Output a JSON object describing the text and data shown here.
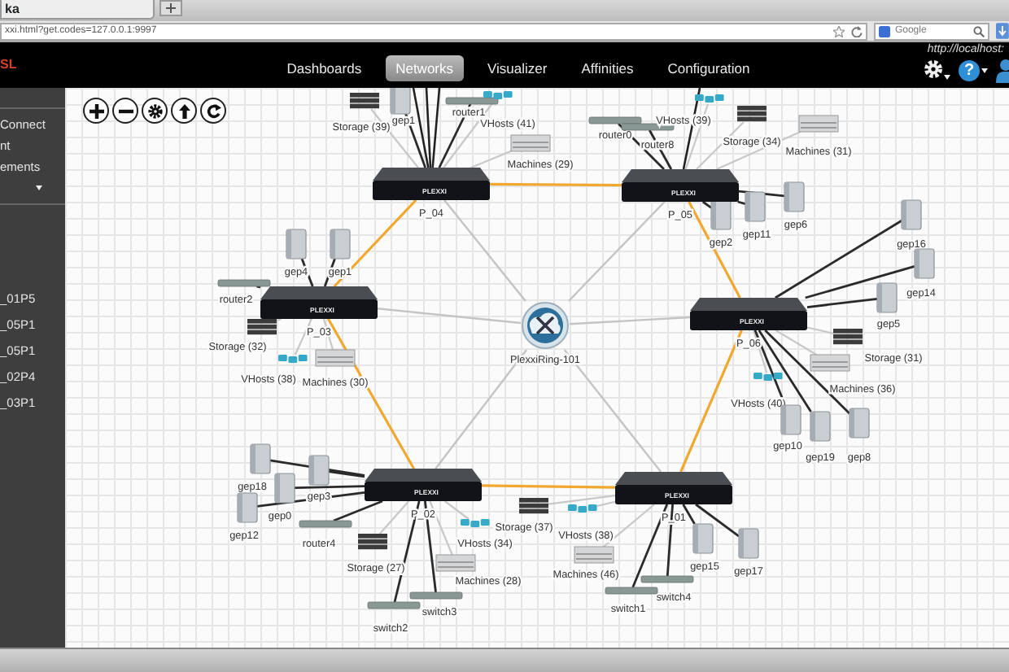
{
  "browser": {
    "tab_title": "ka",
    "url": "xxi.html?get.codes=127.0.0.1:9997",
    "search_placeholder": "Google"
  },
  "header": {
    "logo": "SL",
    "server_url": "http://localhost:",
    "help_glyph": "?",
    "nav": [
      {
        "label": "Dashboards",
        "selected": false
      },
      {
        "label": "Networks",
        "selected": true
      },
      {
        "label": "Visualizer",
        "selected": false
      },
      {
        "label": "Affinities",
        "selected": false
      },
      {
        "label": "Configuration",
        "selected": false
      }
    ]
  },
  "sidebar": {
    "sections": [
      {
        "items": [
          {
            "kind": "link",
            "label": "Connect"
          },
          {
            "kind": "link",
            "label": "nt"
          },
          {
            "kind": "link",
            "label": "ements"
          },
          {
            "kind": "dropdown"
          }
        ]
      },
      {
        "items": [
          {
            "kind": "link",
            "label": "_01P5"
          },
          {
            "kind": "link",
            "label": "_05P1"
          },
          {
            "kind": "link",
            "label": "_05P1"
          },
          {
            "kind": "link",
            "label": "_02P4"
          },
          {
            "kind": "link",
            "label": "_03P1"
          }
        ]
      }
    ]
  },
  "diagram": {
    "hub": {
      "label": "PlexxiRing-101"
    },
    "switches": [
      {
        "label": "P_04",
        "badge": "PLEXXI",
        "devices": [
          {
            "kind": "rack",
            "label": "Storage (39)"
          },
          {
            "kind": "server",
            "label": "gep1"
          },
          {
            "kind": "plate",
            "label": "router1"
          },
          {
            "kind": "vhosts",
            "label": "VHosts (41)"
          },
          {
            "kind": "chassis",
            "label": "Machines (29)"
          }
        ]
      },
      {
        "label": "P_05",
        "badge": "PLEXXI",
        "devices": [
          {
            "kind": "plate",
            "label": "router0"
          },
          {
            "kind": "plate",
            "label": "router8"
          },
          {
            "kind": "vhosts",
            "label": "VHosts (39)"
          },
          {
            "kind": "rack",
            "label": "Storage (34)"
          },
          {
            "kind": "chassis",
            "label": "Machines (31)"
          },
          {
            "kind": "server",
            "label": "gep2"
          },
          {
            "kind": "server",
            "label": "gep11"
          },
          {
            "kind": "server",
            "label": "gep6"
          }
        ]
      },
      {
        "label": "P_03",
        "badge": "PLEXXI",
        "devices": [
          {
            "kind": "server",
            "label": "gep4"
          },
          {
            "kind": "server",
            "label": "gep1"
          },
          {
            "kind": "plate",
            "label": "router2"
          },
          {
            "kind": "rack",
            "label": "Storage (32)"
          },
          {
            "kind": "vhosts",
            "label": "VHosts (38)"
          },
          {
            "kind": "chassis",
            "label": "Machines (30)"
          }
        ]
      },
      {
        "label": "P_06",
        "badge": "PLEXXI",
        "devices": [
          {
            "kind": "server",
            "label": "gep16"
          },
          {
            "kind": "server",
            "label": "gep14"
          },
          {
            "kind": "server",
            "label": "gep5"
          },
          {
            "kind": "rack",
            "label": "Storage (31)"
          },
          {
            "kind": "chassis",
            "label": "Machines (36)"
          },
          {
            "kind": "vhosts",
            "label": "VHosts (40)"
          },
          {
            "kind": "server",
            "label": "gep10"
          },
          {
            "kind": "server",
            "label": "gep19"
          },
          {
            "kind": "server",
            "label": "gep8"
          }
        ]
      },
      {
        "label": "P_02",
        "badge": "PLEXXI",
        "devices": [
          {
            "kind": "server",
            "label": "gep18"
          },
          {
            "kind": "server",
            "label": "gep3"
          },
          {
            "kind": "server",
            "label": "gep0"
          },
          {
            "kind": "server",
            "label": "gep12"
          },
          {
            "kind": "plate",
            "label": "router4"
          },
          {
            "kind": "rack",
            "label": "Storage (27)"
          },
          {
            "kind": "vhosts",
            "label": "VHosts (34)"
          },
          {
            "kind": "chassis",
            "label": "Machines (28)"
          },
          {
            "kind": "plate",
            "label": "switch3"
          },
          {
            "kind": "plate",
            "label": "switch2"
          }
        ]
      },
      {
        "label": "P_01",
        "badge": "PLEXXI",
        "devices": [
          {
            "kind": "rack",
            "label": "Storage (37)"
          },
          {
            "kind": "vhosts",
            "label": "VHosts (38)"
          },
          {
            "kind": "chassis",
            "label": "Machines (46)"
          },
          {
            "kind": "server",
            "label": "gep15"
          },
          {
            "kind": "server",
            "label": "gep17"
          },
          {
            "kind": "plate",
            "label": "switch4"
          },
          {
            "kind": "plate",
            "label": "switch1"
          }
        ]
      }
    ]
  }
}
